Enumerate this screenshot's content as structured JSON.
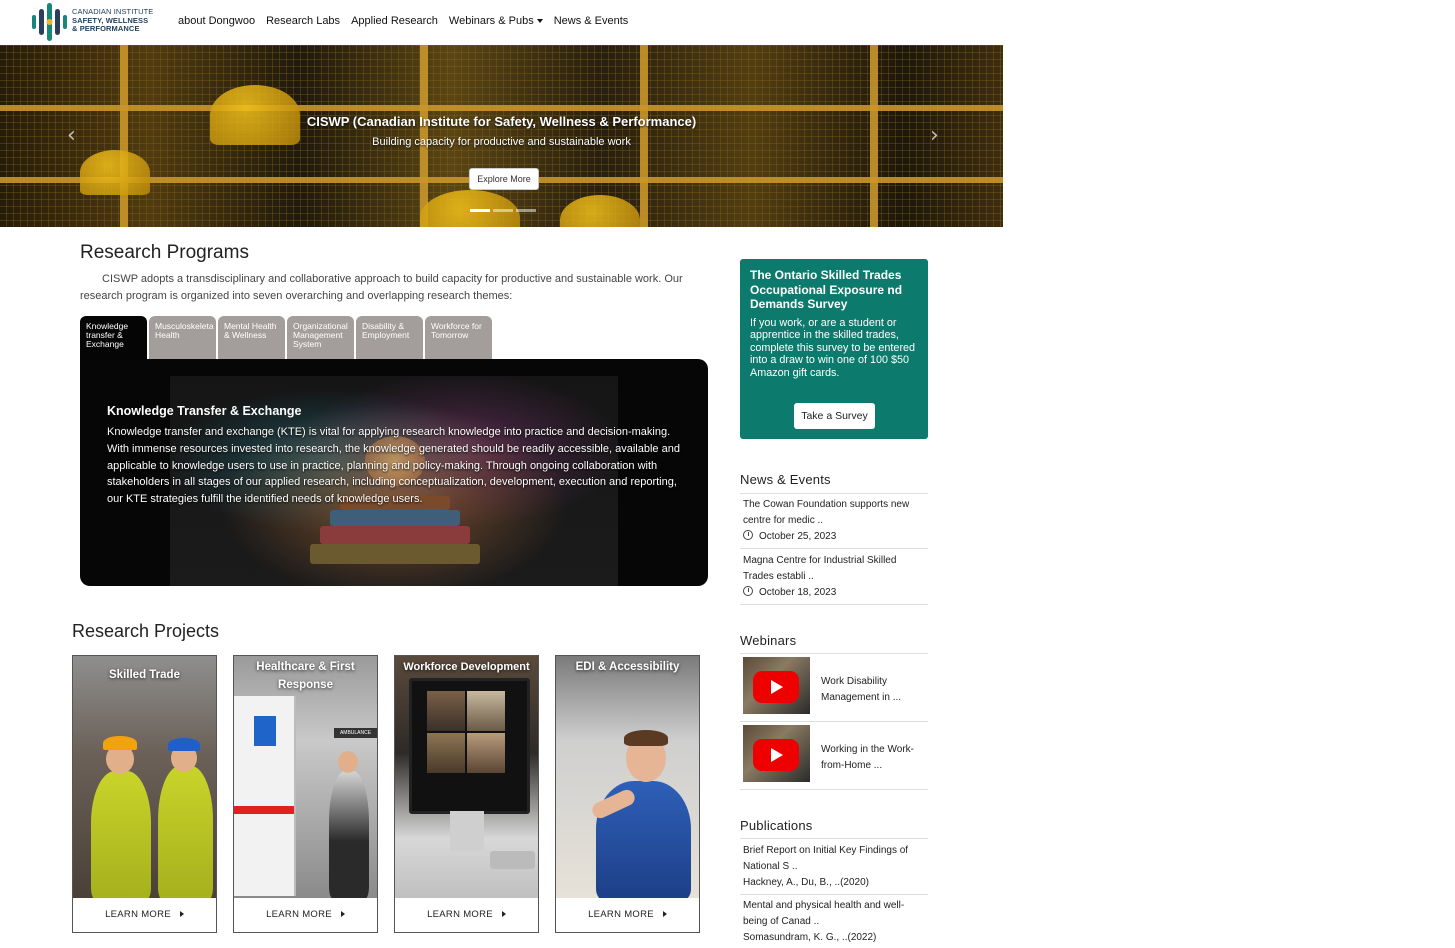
{
  "logo": {
    "line1": "CANADIAN INSTITUTE",
    "line2": "SAFETY, WELLNESS",
    "line3": "& PERFORMANCE"
  },
  "nav": {
    "items": [
      "about Dongwoo",
      "Research Labs",
      "Applied Research",
      "Webinars & Pubs",
      "News & Events"
    ]
  },
  "hero": {
    "title": "CISWP (Canadian Institute for Safety, Wellness & Performance)",
    "subtitle": "Building capacity for productive and sustainable work",
    "button": "Explore More",
    "slide_count": 3,
    "active_slide": 1
  },
  "programs": {
    "title": "Research Programs",
    "description": "CISWP adopts a transdisciplinary and collaborative approach to build capacity for productive and sustainable work. Our research program is organized into seven overarching and overlapping research themes:",
    "tabs": [
      "Knowledge transfer & Exchange",
      "Musculoskeleta Health",
      "Mental Health & Wellness",
      "Organizational Management System",
      "Disability & Employment",
      "Workforce for Tomorrow"
    ],
    "active_tab": 0,
    "panel_title": "Knowledge Transfer & Exchange",
    "panel_text": "Knowledge transfer and exchange (KTE) is vital for applying research knowledge into practice and decision-making. With immense resources invested into research, the knowledge generated should be readily accessible, available and applicable to knowledge users to use in practice, planning and policy-making. Through ongoing collaboration with stakeholders in all stages of our applied research, including conceptualization, development, execution and reporting, our KTE strategies fulfill the identified needs of knowledge users."
  },
  "projects": {
    "title": "Research Projects",
    "cards": [
      {
        "title": "Skilled Trade",
        "link": "LEARN MORE"
      },
      {
        "title": "Healthcare & First Response",
        "link": "LEARN MORE"
      },
      {
        "title": "Workforce Development",
        "link": "LEARN MORE"
      },
      {
        "title": "EDI & Accessibility",
        "link": "LEARN MORE"
      }
    ],
    "ambulance_sign": "AMBULANCE"
  },
  "survey": {
    "title": "The Ontario Skilled Trades Occupational Exposure nd Demands Survey",
    "text": "If you work, or are a student or apprentice in the skilled trades, complete this survey to be entered into a draw to win one of 100 $50 Amazon gift cards.",
    "button": "Take a Survey",
    "color": "#0c7a6c"
  },
  "news": {
    "title": "News & Events",
    "items": [
      {
        "text": "The Cowan Foundation supports new centre for medic ..",
        "date": "October 25, 2023"
      },
      {
        "text": "Magna Centre for Industrial Skilled Trades establi ..",
        "date": "October 18, 2023"
      }
    ]
  },
  "webinars": {
    "title": "Webinars",
    "items": [
      {
        "label": "Work Disability Management in ..."
      },
      {
        "label": "Working in the Work-from-Home ..."
      }
    ]
  },
  "publications": {
    "title": "Publications",
    "items": [
      {
        "text": "Brief Report on Initial Key Findings of National S ..",
        "authors": "Hackney, A., Du, B., ..(2020)"
      },
      {
        "text": "Mental and physical health and well-being of Canad ..",
        "authors": "Somasundram, K. G., ..(2022)"
      }
    ]
  }
}
